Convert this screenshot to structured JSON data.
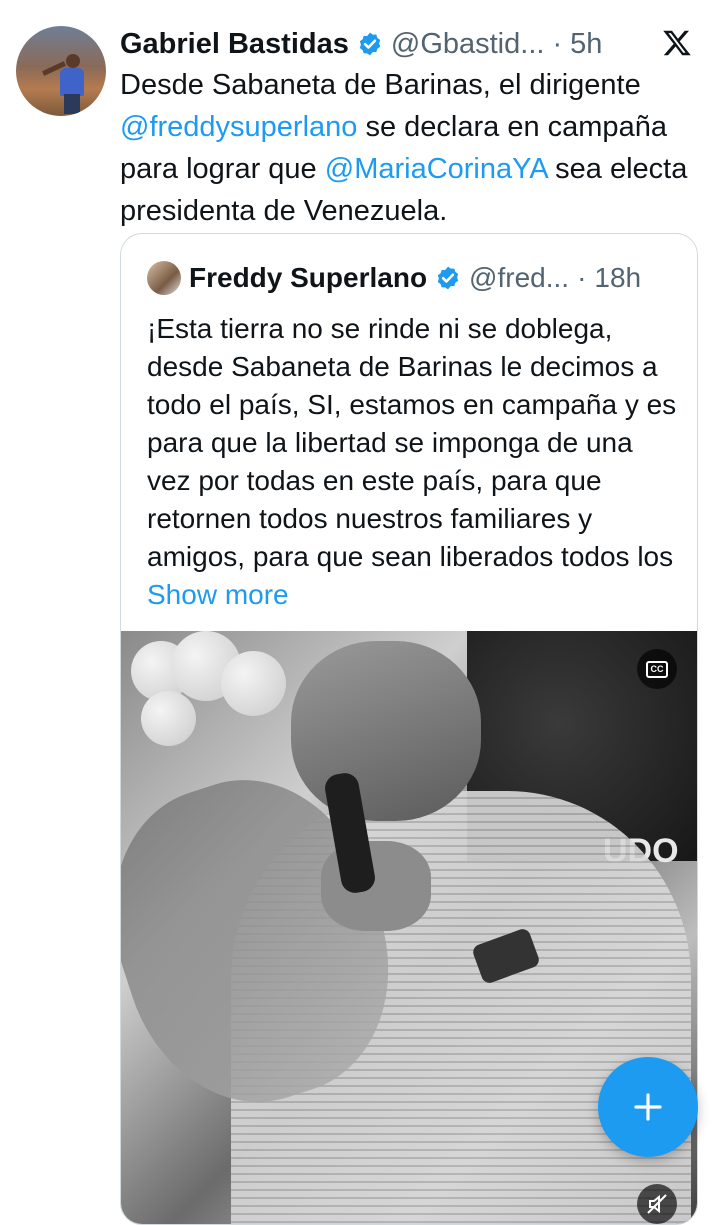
{
  "tweet": {
    "author_name": "Gabriel Bastidas",
    "handle": "@Gbastid...",
    "separator": "·",
    "time": "5h",
    "text_part1": "Desde Sabaneta de Barinas, el dirigente ",
    "mention1": "@freddysuperlano",
    "text_part2": " se declara en campaña para lograr que ",
    "mention2": "@MariaCorinaYA",
    "text_part3": " sea electa presidenta de Venezuela."
  },
  "quoted": {
    "author_name": "Freddy Superlano",
    "handle": "@fred...",
    "separator": "·",
    "time": "18h",
    "text": "¡Esta tierra no se rinde ni se doblega, desde Sabaneta de Barinas le decimos a todo el país, SI, estamos en campaña y es para que la libertad se imponga de una vez por todas en este país, para que retornen todos nuestros familiares y amigos, para que sean liberados todos los ",
    "show_more": "Show more",
    "video_sign_text": "UDO"
  },
  "icons": {
    "verified": "verified-badge-icon",
    "x_logo": "x-logo-icon",
    "captions": "cc-icon",
    "mute": "mute-icon",
    "compose": "plus-icon"
  },
  "colors": {
    "accent": "#1d9bf0",
    "secondary_text": "#536471",
    "border": "#cfd9de"
  }
}
